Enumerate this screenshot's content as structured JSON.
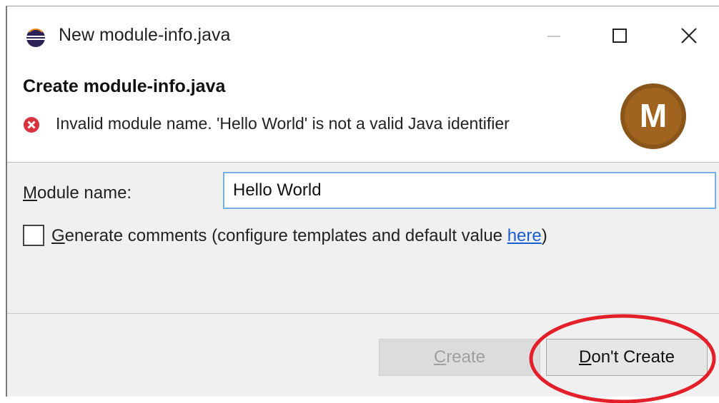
{
  "window": {
    "title": "New module-info.java",
    "icon": "eclipse-icon",
    "controls": [
      "minimize",
      "maximize",
      "close"
    ]
  },
  "header": {
    "title": "Create module-info.java",
    "error_message": "Invalid module name. 'Hello World' is not a valid Java identifier",
    "error_icon": "error-icon",
    "banner_letter": "M"
  },
  "form": {
    "module_label_mnemonic": "M",
    "module_label_rest": "odule name:",
    "module_value": "Hello World",
    "generate_checked": false,
    "generate_label_mnemonic": "G",
    "generate_label_rest": "enerate comments",
    "generate_hint_prefix": " (configure templates and default value ",
    "generate_hint_link": "here",
    "generate_hint_suffix": ")"
  },
  "buttons": {
    "create_mnemonic": "C",
    "create_rest": "reate",
    "create_enabled": false,
    "dont_create_mnemonic": "D",
    "dont_create_rest": "on't Create"
  },
  "colors": {
    "highlight_circle": "#e3202a",
    "banner_brown": "#8a5518",
    "error_red": "#d9333f",
    "link_blue": "#1a5fd0",
    "input_border": "#7aaee0"
  }
}
